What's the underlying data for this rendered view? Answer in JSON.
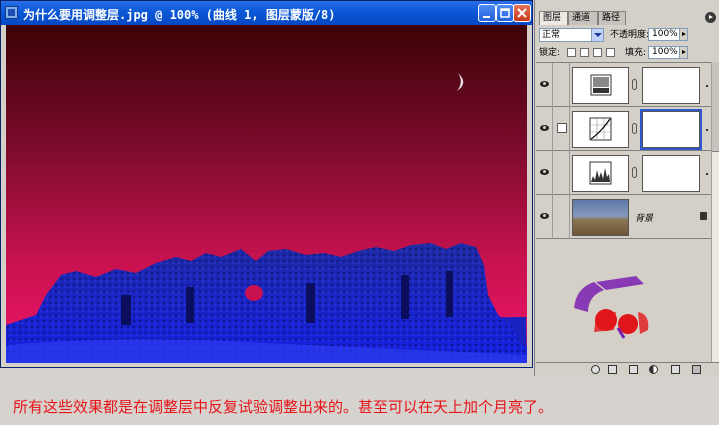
{
  "document_window": {
    "title": "为什么要用调整层.jpg @ 100% (曲线 1, 图层蒙版/8)",
    "icons": {
      "app": "photoshop-doc-icon",
      "minimize": "minimize-icon",
      "maximize": "maximize-icon",
      "close": "close-icon"
    }
  },
  "layers_panel": {
    "tabs": [
      "图层",
      "通道",
      "路径"
    ],
    "active_tab": 0,
    "blend_mode": "正常",
    "opacity_label": "不透明度:",
    "opacity_value": "100%",
    "lock_label": "锁定:",
    "fill_label": "填充:",
    "fill_value": "100%",
    "layers": [
      {
        "type": "adjustment-levels",
        "selected": false,
        "thumb_icon": "levels-icon"
      },
      {
        "type": "adjustment-curves",
        "selected": true,
        "thumb_icon": "curves-icon"
      },
      {
        "type": "adjustment-histogram",
        "selected": false,
        "thumb_icon": "histogram-icon"
      },
      {
        "type": "background",
        "name": "背景",
        "selected": false
      }
    ]
  },
  "caption": "所有这些效果都是在调整层中反复试验调整出来的。甚至可以在天上加个月亮了。",
  "colors": {
    "caption": "#e8141a",
    "titlebar": "#0a58d6",
    "selection": "#2d56cf"
  }
}
